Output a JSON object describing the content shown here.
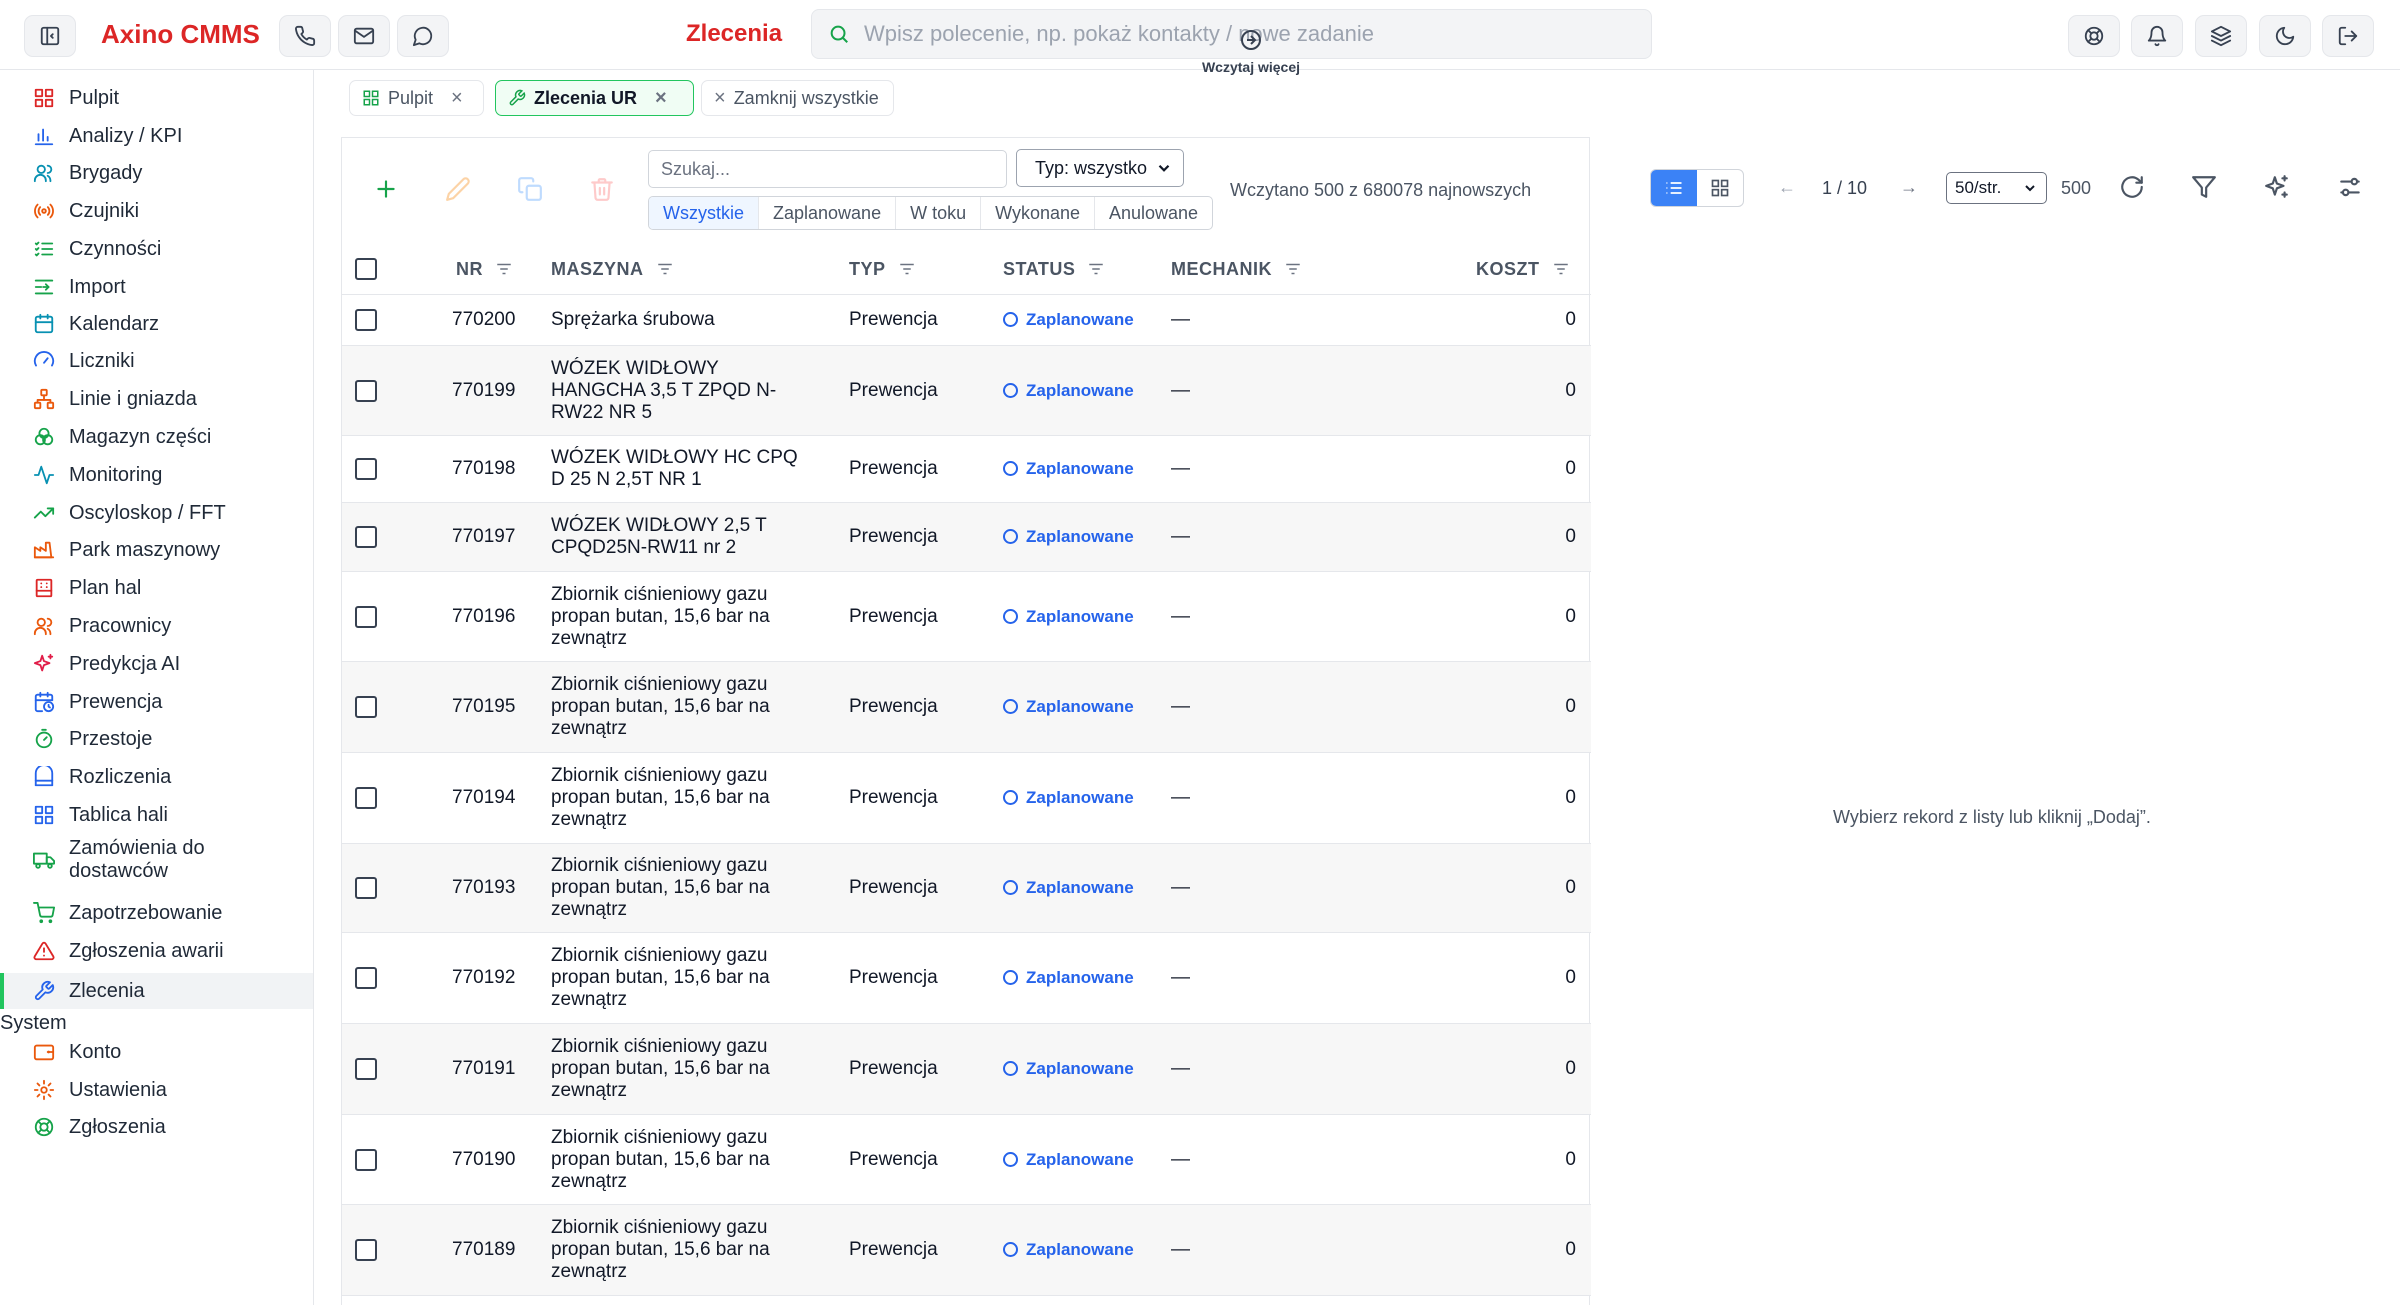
{
  "app": {
    "brand": "Axino CMMS",
    "page_title": "Zlecenia"
  },
  "command_bar": {
    "placeholder": "Wpisz polecenie, np. pokaż kontakty / nowe zadanie"
  },
  "topbar_icons": [
    "sidebar-toggle-icon",
    "phone-icon",
    "mail-icon",
    "chat-icon",
    "help-icon",
    "bell-icon",
    "layers-icon",
    "moon-icon",
    "logout-icon"
  ],
  "sidebar": {
    "items": [
      {
        "label": "Pulpit",
        "icon": "dashboard-icon",
        "color": "#dc2626"
      },
      {
        "label": "Analizy / KPI",
        "icon": "bar-chart-icon",
        "color": "#2563eb"
      },
      {
        "label": "Brygady",
        "icon": "users-icon",
        "color": "#0891b2"
      },
      {
        "label": "Czujniki",
        "icon": "radio-icon",
        "color": "#ea580c"
      },
      {
        "label": "Czynności",
        "icon": "list-icon",
        "color": "#16a34a"
      },
      {
        "label": "Import",
        "icon": "import-icon",
        "color": "#16a34a"
      },
      {
        "label": "Kalendarz",
        "icon": "calendar-icon",
        "color": "#0891b2"
      },
      {
        "label": "Liczniki",
        "icon": "gauge-icon",
        "color": "#2563eb"
      },
      {
        "label": "Linie i gniazda",
        "icon": "network-icon",
        "color": "#ea580c"
      },
      {
        "label": "Magazyn części",
        "icon": "boxes-icon",
        "color": "#16a34a"
      },
      {
        "label": "Monitoring",
        "icon": "activity-icon",
        "color": "#0891b2"
      },
      {
        "label": "Oscyloskop / FFT",
        "icon": "trend-icon",
        "color": "#16a34a"
      },
      {
        "label": "Park maszynowy",
        "icon": "factory-icon",
        "color": "#ea580c"
      },
      {
        "label": "Plan hal",
        "icon": "building-icon",
        "color": "#dc2626"
      },
      {
        "label": "Pracownicy",
        "icon": "users-icon",
        "color": "#ea580c"
      },
      {
        "label": "Predykcja AI",
        "icon": "sparkles-icon",
        "color": "#e11d48"
      },
      {
        "label": "Prewencja",
        "icon": "calendar-clock-icon",
        "color": "#2563eb"
      },
      {
        "label": "Przestoje",
        "icon": "timer-icon",
        "color": "#16a34a"
      },
      {
        "label": "Rozliczenia",
        "icon": "receipt-icon",
        "color": "#2563eb"
      },
      {
        "label": "Tablica hali",
        "icon": "grid-icon",
        "color": "#2563eb"
      },
      {
        "label": "Zamówienia do dostawców",
        "icon": "truck-icon",
        "color": "#16a34a"
      },
      {
        "label": "Zapotrzebowanie",
        "icon": "cart-icon",
        "color": "#16a34a"
      },
      {
        "label": "Zgłoszenia awarii",
        "icon": "alert-icon",
        "color": "#dc2626"
      },
      {
        "label": "Zlecenia",
        "icon": "wrench-icon",
        "color": "#2563eb"
      }
    ],
    "section_system": "System",
    "system_items": [
      {
        "label": "Konto",
        "icon": "wallet-icon",
        "color": "#ea580c"
      },
      {
        "label": "Ustawienia",
        "icon": "gear-icon",
        "color": "#ea580c"
      },
      {
        "label": "Zgłoszenia",
        "icon": "lifebuoy-icon",
        "color": "#16a34a"
      }
    ]
  },
  "tabs": [
    {
      "label": "Pulpit",
      "close": "×"
    },
    {
      "label": "Zlecenia UR",
      "close": "×"
    },
    {
      "label": "Zamknij wszystkie",
      "prefix": "×"
    }
  ],
  "toolbar": {
    "search_placeholder": "Szukaj...",
    "type_filter": "Typ: wszystko",
    "status_filters": [
      "Wszystkie",
      "Zaplanowane",
      "W toku",
      "Wykonane",
      "Anulowane"
    ],
    "active_status": "Wszystkie",
    "loaded_info": "Wczytano 500 z 680078 najnowszych",
    "load_more": "Wczytaj więcej",
    "pager_prev": "←",
    "pager_position": "1 / 10",
    "pager_next": "→",
    "per_page": "50/str.",
    "total": "500"
  },
  "table": {
    "columns": [
      "NR",
      "MASZYNA",
      "TYP",
      "STATUS",
      "MECHANIK",
      "KOSZT"
    ],
    "rows": [
      {
        "nr": "770200",
        "maszyna": "Sprężarka śrubowa",
        "typ": "Prewencja",
        "status": "Zaplanowane",
        "mechanik": "—",
        "koszt": "0"
      },
      {
        "nr": "770199",
        "maszyna": "WÓZEK WIDŁOWY HANGCHA 3,5 T ZPQD N-RW22 NR 5",
        "typ": "Prewencja",
        "status": "Zaplanowane",
        "mechanik": "—",
        "koszt": "0"
      },
      {
        "nr": "770198",
        "maszyna": "WÓZEK WIDŁOWY HC CPQ D 25 N 2,5T NR 1",
        "typ": "Prewencja",
        "status": "Zaplanowane",
        "mechanik": "—",
        "koszt": "0"
      },
      {
        "nr": "770197",
        "maszyna": "WÓZEK WIDŁOWY 2,5 T CPQD25N-RW11 nr 2",
        "typ": "Prewencja",
        "status": "Zaplanowane",
        "mechanik": "—",
        "koszt": "0"
      },
      {
        "nr": "770196",
        "maszyna": "Zbiornik ciśnieniowy gazu propan butan, 15,6 bar na zewnątrz",
        "typ": "Prewencja",
        "status": "Zaplanowane",
        "mechanik": "—",
        "koszt": "0"
      },
      {
        "nr": "770195",
        "maszyna": "Zbiornik ciśnieniowy gazu propan butan, 15,6 bar na zewnątrz",
        "typ": "Prewencja",
        "status": "Zaplanowane",
        "mechanik": "—",
        "koszt": "0"
      },
      {
        "nr": "770194",
        "maszyna": "Zbiornik ciśnieniowy gazu propan butan, 15,6 bar na zewnątrz",
        "typ": "Prewencja",
        "status": "Zaplanowane",
        "mechanik": "—",
        "koszt": "0"
      },
      {
        "nr": "770193",
        "maszyna": "Zbiornik ciśnieniowy gazu propan butan, 15,6 bar na zewnątrz",
        "typ": "Prewencja",
        "status": "Zaplanowane",
        "mechanik": "—",
        "koszt": "0"
      },
      {
        "nr": "770192",
        "maszyna": "Zbiornik ciśnieniowy gazu propan butan, 15,6 bar na zewnątrz",
        "typ": "Prewencja",
        "status": "Zaplanowane",
        "mechanik": "—",
        "koszt": "0"
      },
      {
        "nr": "770191",
        "maszyna": "Zbiornik ciśnieniowy gazu propan butan, 15,6 bar na zewnątrz",
        "typ": "Prewencja",
        "status": "Zaplanowane",
        "mechanik": "—",
        "koszt": "0"
      },
      {
        "nr": "770190",
        "maszyna": "Zbiornik ciśnieniowy gazu propan butan, 15,6 bar na zewnątrz",
        "typ": "Prewencja",
        "status": "Zaplanowane",
        "mechanik": "—",
        "koszt": "0"
      },
      {
        "nr": "770189",
        "maszyna": "Zbiornik ciśnieniowy gazu propan butan, 15,6 bar na zewnątrz",
        "typ": "Prewencja",
        "status": "Zaplanowane",
        "mechanik": "—",
        "koszt": "0"
      }
    ]
  },
  "detail": {
    "hint": "Wybierz rekord z listy lub kliknij „Dodaj”."
  },
  "colors": {
    "brand": "#dc2626",
    "accent": "#2563eb",
    "active_border": "#22c55e"
  }
}
